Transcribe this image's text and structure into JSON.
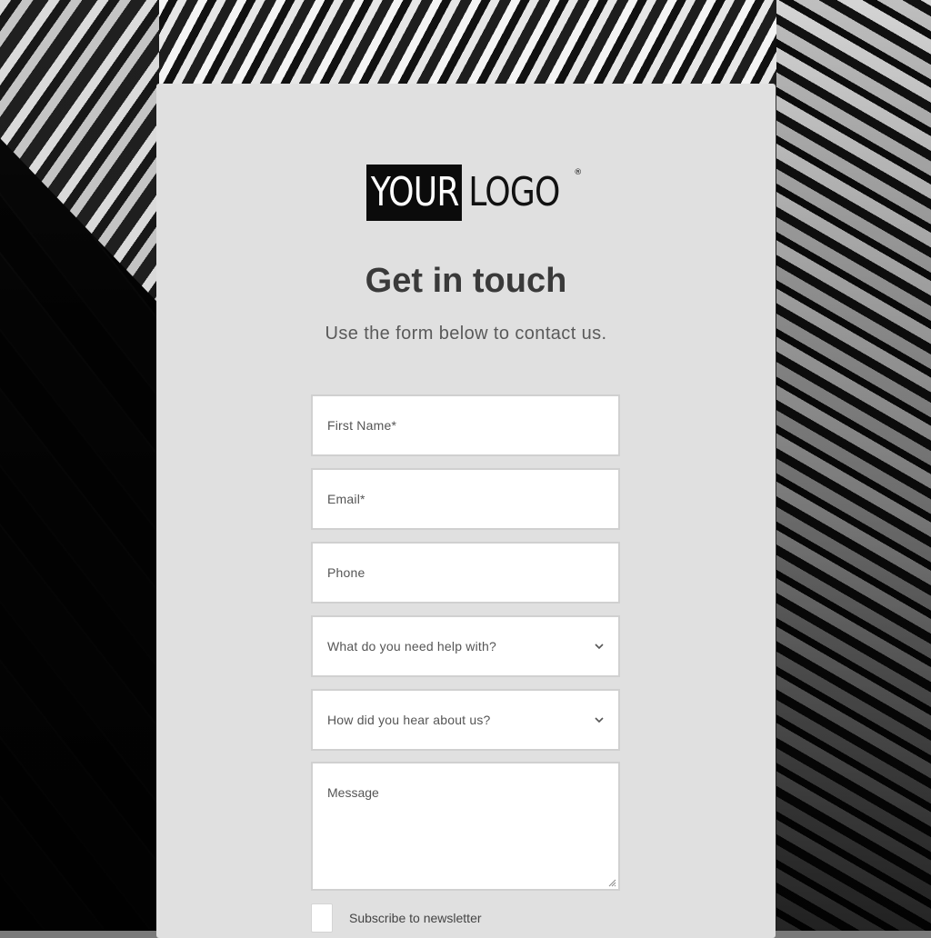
{
  "logo": {
    "part1": "YOUR",
    "part2": "LOGO",
    "mark": "®"
  },
  "heading": {
    "title": "Get in touch",
    "subtitle": "Use the form below to contact us."
  },
  "form": {
    "first_name": {
      "placeholder": "First Name*"
    },
    "email": {
      "placeholder": "Email*"
    },
    "phone": {
      "placeholder": "Phone"
    },
    "help_topic": {
      "placeholder": "What do you need help with?",
      "icon": "chevron-down-icon"
    },
    "referral": {
      "placeholder": "How did you hear about us?",
      "icon": "chevron-down-icon"
    },
    "message": {
      "placeholder": "Message"
    },
    "newsletter": {
      "label": "Subscribe to newsletter",
      "checked": false
    }
  },
  "colors": {
    "card_bg": "#e0e0e0",
    "field_bg": "#ffffff",
    "title": "#3a3a3a",
    "logo_block": "#0b0b0b"
  }
}
